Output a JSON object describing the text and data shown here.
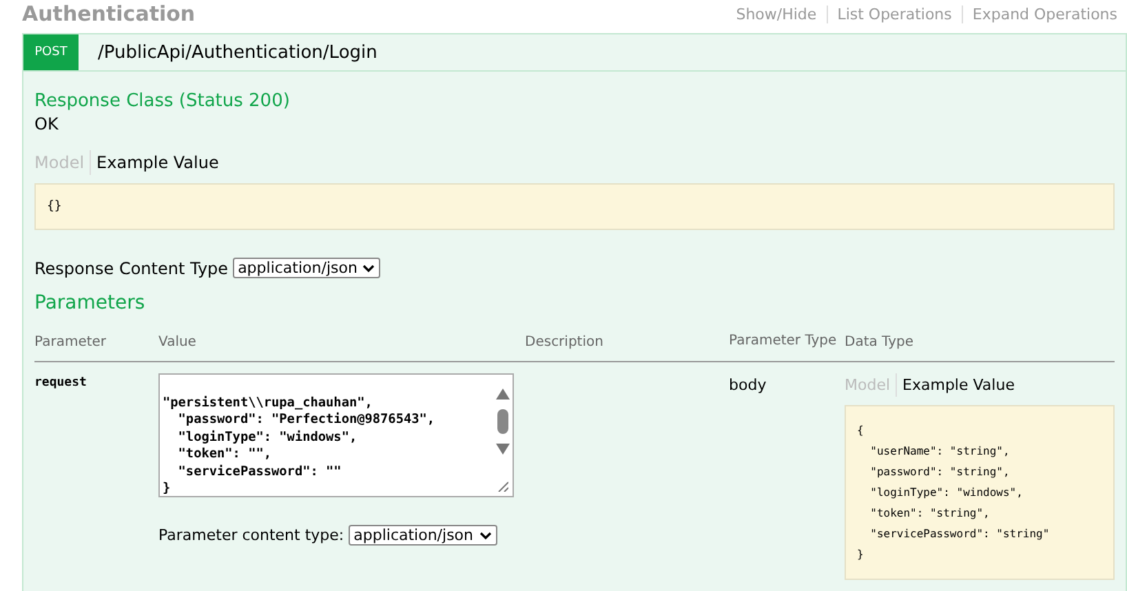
{
  "resource": {
    "title": "Authentication",
    "links": [
      "Show/Hide",
      "List Operations",
      "Expand Operations"
    ]
  },
  "operation": {
    "method": "POST",
    "path": "/PublicApi/Authentication/Login"
  },
  "response_class": {
    "heading": "Response Class (Status 200)",
    "status_text": "OK",
    "tabs": [
      {
        "label": "Model",
        "selected": false
      },
      {
        "label": "Example Value",
        "selected": true
      }
    ],
    "example": "{}"
  },
  "response_content_type": {
    "label": "Response Content Type",
    "value": "application/json"
  },
  "parameters": {
    "heading": "Parameters",
    "columns": [
      "Parameter",
      "Value",
      "Description",
      "Parameter Type",
      "Data Type"
    ],
    "rows": [
      {
        "name": "request",
        "value_lines": [
          "\"persistent\\\\rupa_chauhan\",",
          "  \"password\": \"Perfection@9876543\",",
          "  \"loginType\": \"windows\",",
          "  \"token\": \"\",",
          "  \"servicePassword\": \"\"",
          "}"
        ],
        "parameter_type": "body",
        "data_type_tabs": [
          {
            "label": "Model",
            "selected": false
          },
          {
            "label": "Example Value",
            "selected": true
          }
        ],
        "example_lines": [
          "{",
          "  \"userName\": \"string\",",
          "  \"password\": \"string\",",
          "  \"loginType\": \"windows\",",
          "  \"token\": \"string\",",
          "  \"servicePassword\": \"string\"",
          "}"
        ],
        "content_type_label": "Parameter content type:",
        "content_type_value": "application/json"
      }
    ]
  }
}
